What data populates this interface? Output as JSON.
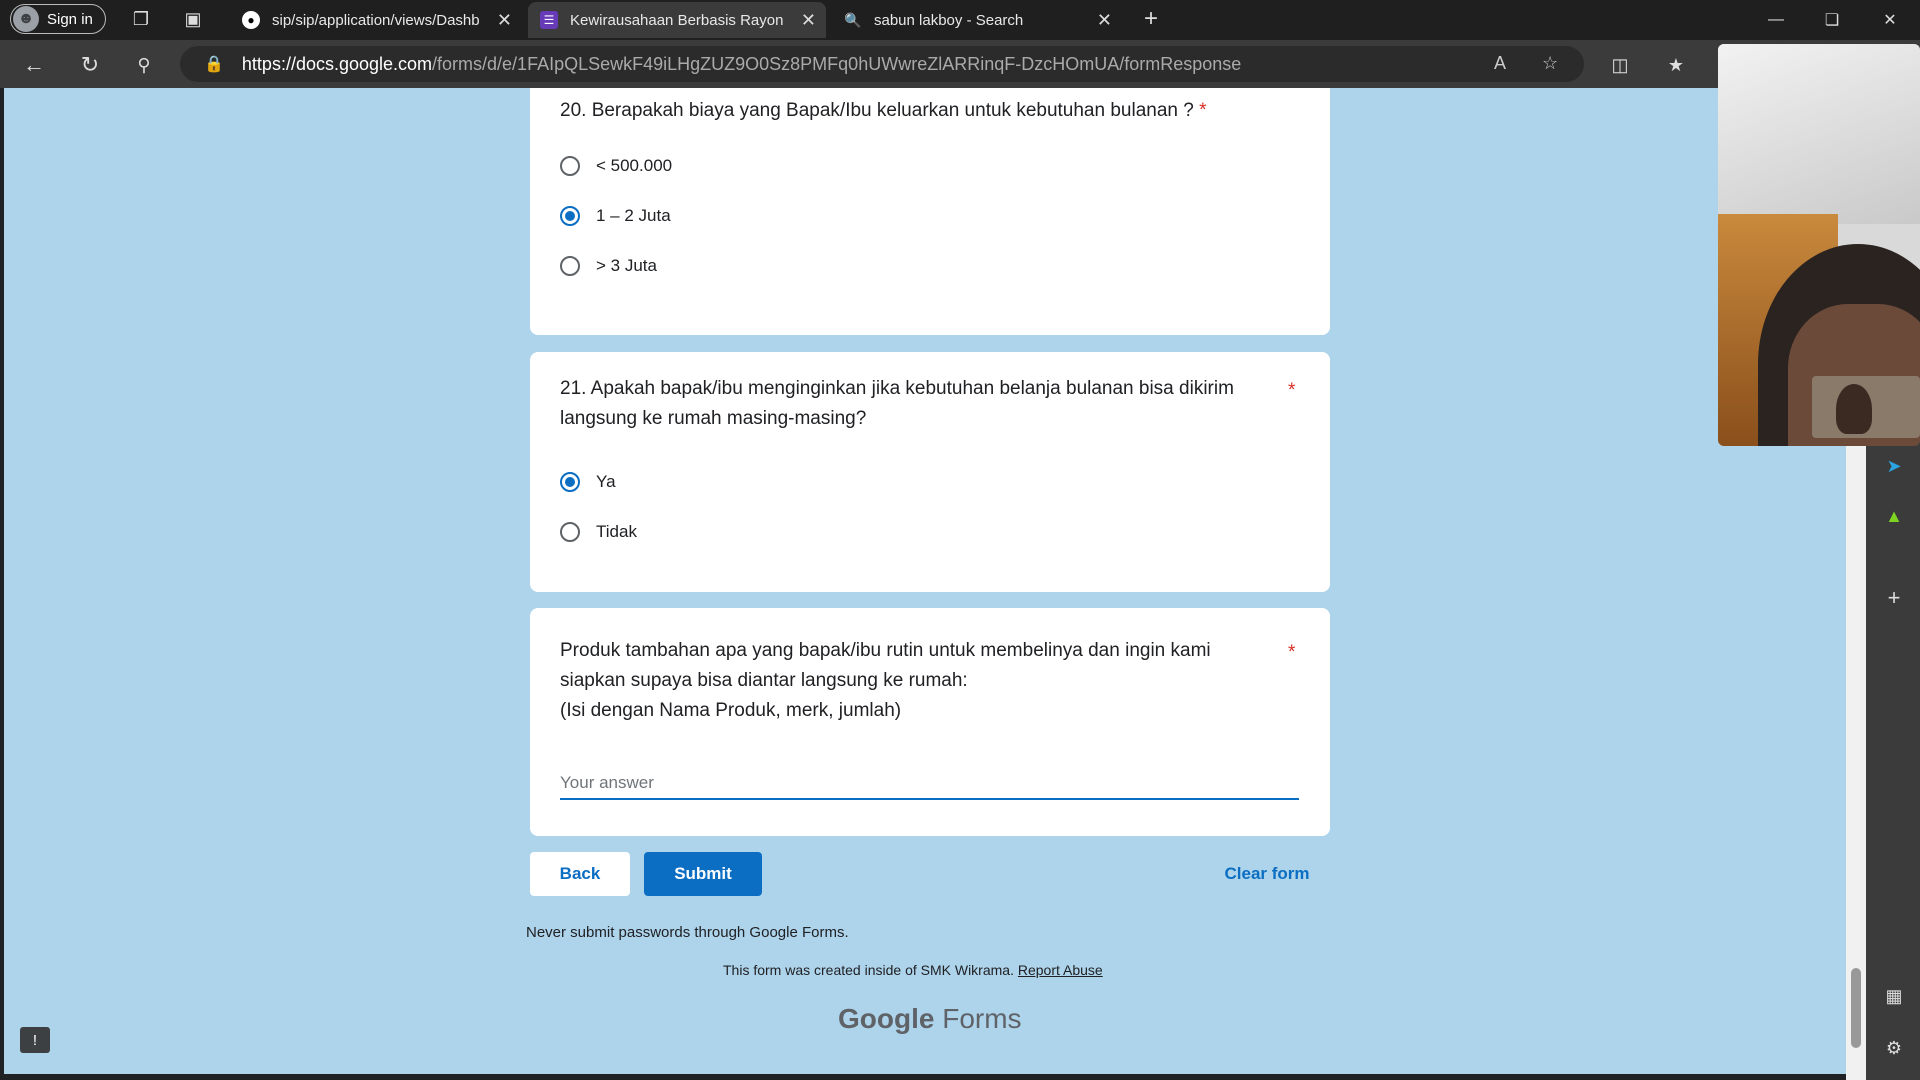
{
  "browser": {
    "signin_label": "Sign in",
    "tabs": [
      {
        "title": "sip/sip/application/views/Dashb",
        "icon": "github-icon"
      },
      {
        "title": "Kewirausahaan Berbasis Rayon",
        "icon": "google-forms-icon"
      },
      {
        "title": "sabun lakboy - Search",
        "icon": "search-icon"
      }
    ],
    "url_host": "https://docs.google.com",
    "url_path": "/forms/d/e/1FAIpQLSewkF49iLHgZUZ9O0Sz8PMFq0hUWwreZlARRinqF-DzcHOmUA/formResponse"
  },
  "form": {
    "q20": {
      "text": "20. Berapakah biaya yang Bapak/Ibu keluarkan untuk kebutuhan bulanan ?",
      "required": "*",
      "options": [
        "< 500.000",
        "1 – 2 Juta",
        "> 3 Juta"
      ],
      "selected": "1 – 2 Juta"
    },
    "q21": {
      "line1": "21. Apakah bapak/ibu menginginkan jika kebutuhan belanja bulanan bisa dikirim",
      "line2": "langsung ke rumah masing-masing?",
      "required": "*",
      "options": [
        "Ya",
        "Tidak"
      ],
      "selected": "Ya"
    },
    "q22": {
      "line1": "Produk tambahan apa yang bapak/ibu rutin untuk membelinya dan ingin kami",
      "line2": "siapkan supaya bisa diantar langsung ke rumah:",
      "line3": "(Isi dengan Nama Produk, merk, jumlah)",
      "required": "*",
      "placeholder": "Your answer"
    },
    "back_label": "Back",
    "submit_label": "Submit",
    "clear_label": "Clear form",
    "warning": "Never submit passwords through Google Forms.",
    "created_text": "This form was created inside of SMK Wikrama.",
    "report_label": "Report Abuse",
    "logo_google": "Google",
    "logo_forms": "Forms"
  },
  "colors": {
    "accent": "#0b6ec2",
    "background": "#aed4ec",
    "required": "#d93025"
  }
}
